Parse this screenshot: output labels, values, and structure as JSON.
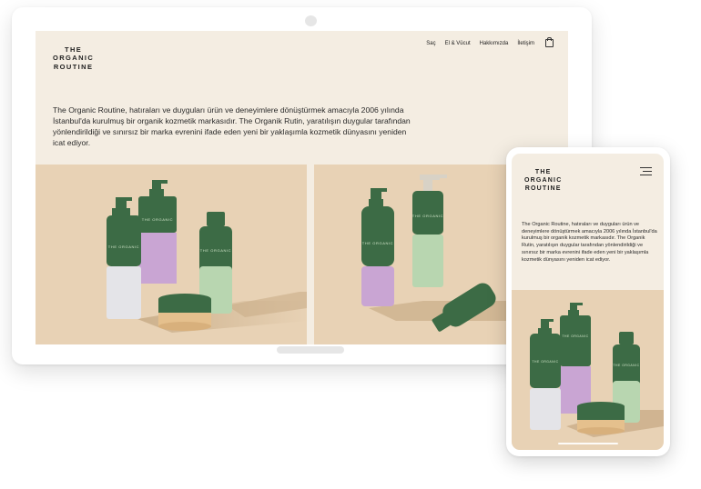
{
  "brand": {
    "logo_lines": [
      "THE",
      "ORGANIC",
      "ROUTINE"
    ]
  },
  "desktop": {
    "nav": [
      {
        "label": "Saç"
      },
      {
        "label": "El & Vücut"
      },
      {
        "label": "Hakkımızda"
      },
      {
        "label": "İletişim"
      }
    ],
    "cart_icon": "shopping-bag-icon",
    "intro": "The Organic Routine, hatıraları ve duyguları ürün ve deneyimlere dönüştürmek amacıyla 2006 yılında İstanbul'da kurulmuş bir organik kozmetik markasıdır. The Organik Rutin, yaratılışın duygular tarafından yönlendirildiği ve sınırsız bir marka evrenini ifade eden yeni bir yaklaşımla kozmetik dünyasını yeniden icat ediyor."
  },
  "mobile": {
    "menu_icon": "hamburger-menu-icon",
    "intro": "The Organic Routine, hatıraları ve duyguları ürün ve deneyimlere dönüştürmek amacıyla 2006 yılında İstanbul'da kurulmuş bir organik kozmetik markasıdır. The Organik Rutin, yaratılışın duygular tarafından yönlendirildiği ve sınırsız bir marka evrenini ifade eden yeni bir yaklaşımla kozmetik dünyasını yeniden icat ediyor."
  },
  "colors": {
    "page_bg": "#f4ede2",
    "photo_bg": "#e8d2b5",
    "bottle_green": "#3c6b45",
    "label_grey": "#e4e4e8",
    "label_lilac": "#c9a5d3",
    "label_mint": "#b8d6b0",
    "jar_band": "#e5c08d"
  }
}
